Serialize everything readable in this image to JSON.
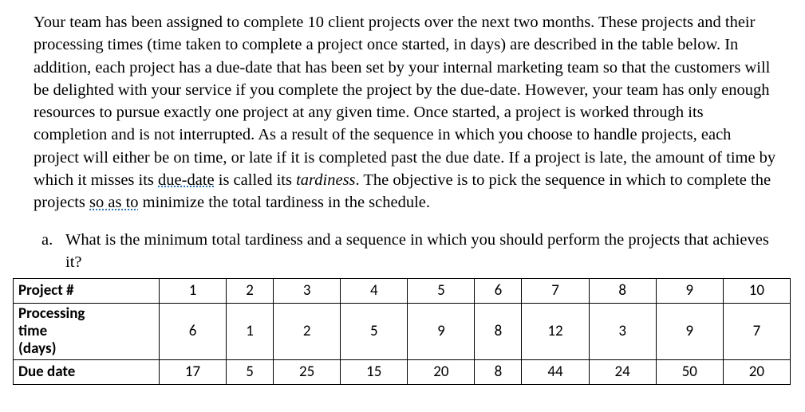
{
  "paragraph": {
    "p1": "Your team has been assigned to complete 10 client projects over the next two months. These projects and their processing times (time taken to complete a project once started, in days) are described in the table below. In addition, each project has a due-date that has been set by your internal marketing team so that the customers will be delighted with your service if you complete the project by the due-date. However, your team has only enough resources to pursue exactly one project at any given time. Once started, a project is worked through its completion and is not interrupted. As a result of the sequence in which you choose to handle projects, each project will either be on time, or late if it is completed past the due date. If a project is late, the amount of time by which it misses its ",
    "sq1": "due-date",
    "p2": " is called its ",
    "term": "tardiness",
    "p3": ". The objective is to pick the sequence in which to complete the projects ",
    "sq2": "so as to",
    "p4": " minimize the total tardiness in the schedule."
  },
  "question": {
    "marker": "a.",
    "text": "What is the minimum total tardiness and a sequence in which you should perform the projects that achieves it?"
  },
  "table": {
    "head_label": "Project #",
    "cols": [
      "1",
      "2",
      "3",
      "4",
      "5",
      "6",
      "7",
      "8",
      "9",
      "10"
    ],
    "rows": [
      {
        "label": "Processing time (days)",
        "html_label": "Processing<br>time<br>(days)",
        "values": [
          "6",
          "1",
          "2",
          "5",
          "9",
          "8",
          "12",
          "3",
          "9",
          "7"
        ]
      },
      {
        "label": "Due date",
        "html_label": "Due date",
        "values": [
          "17",
          "5",
          "25",
          "15",
          "20",
          "8",
          "44",
          "24",
          "50",
          "20"
        ]
      }
    ]
  },
  "chart_data": {
    "type": "table",
    "title": "Project scheduling data",
    "columns": [
      "Project #",
      "1",
      "2",
      "3",
      "4",
      "5",
      "6",
      "7",
      "8",
      "9",
      "10"
    ],
    "rows": [
      [
        "Processing time (days)",
        6,
        1,
        2,
        5,
        9,
        8,
        12,
        3,
        9,
        7
      ],
      [
        "Due date",
        17,
        5,
        25,
        15,
        20,
        8,
        44,
        24,
        50,
        20
      ]
    ]
  }
}
